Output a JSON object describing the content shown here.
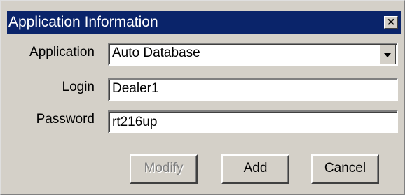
{
  "window": {
    "title": "Application Information",
    "close_glyph": "×"
  },
  "form": {
    "application_label": "Application",
    "application_value": "Auto Database",
    "login_label": "Login",
    "login_value": "Dealer1",
    "password_label": "Password",
    "password_value": "rt216up"
  },
  "buttons": {
    "modify_label": "Modify",
    "modify_enabled": false,
    "add_label": "Add",
    "cancel_label": "Cancel"
  },
  "colors": {
    "title_bar": "#0a246a",
    "face": "#d4d0c8"
  }
}
